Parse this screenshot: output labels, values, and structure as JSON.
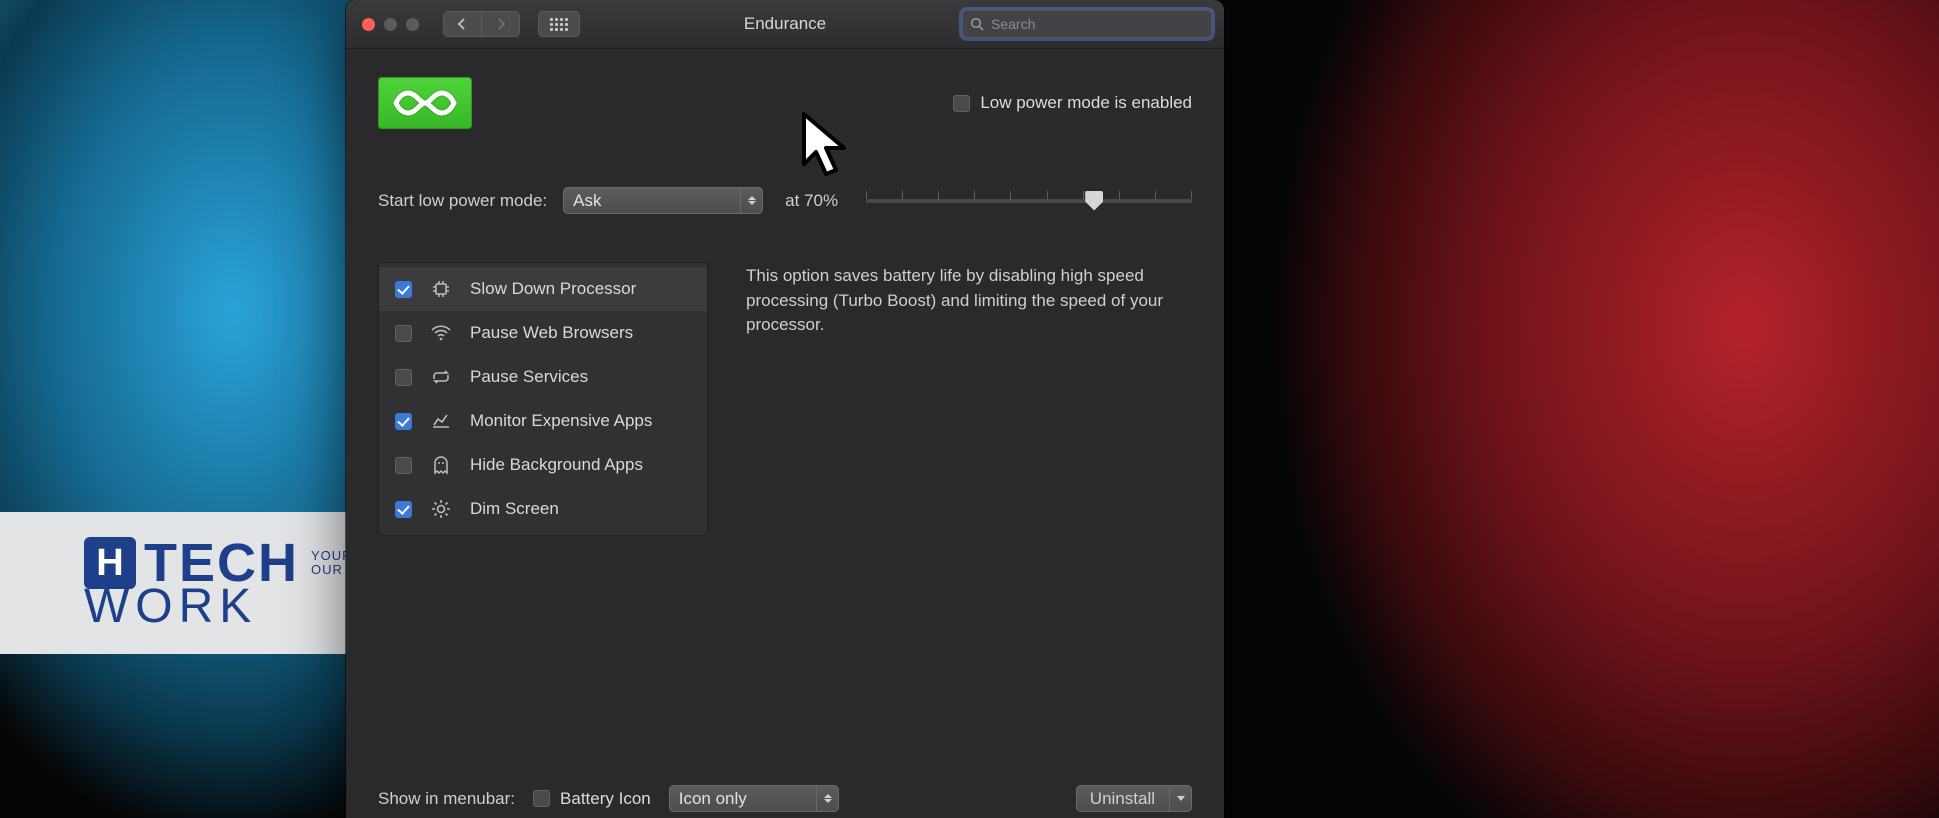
{
  "window": {
    "title": "Endurance"
  },
  "search": {
    "placeholder": "Search",
    "value": ""
  },
  "low_power_mode": {
    "checkbox_label": "Low power mode is enabled",
    "checked": false
  },
  "start_mode": {
    "label": "Start low power mode:",
    "select_value": "Ask",
    "at_label": "at 70%",
    "slider_percent": 70,
    "slider_tick_count": 10
  },
  "features": [
    {
      "id": "slow-cpu",
      "label": "Slow Down Processor",
      "checked": true,
      "icon": "cpu-icon",
      "selected": true
    },
    {
      "id": "pause-web",
      "label": "Pause Web Browsers",
      "checked": false,
      "icon": "wifi-icon",
      "selected": false
    },
    {
      "id": "pause-svc",
      "label": "Pause Services",
      "checked": false,
      "icon": "loop-icon",
      "selected": false
    },
    {
      "id": "mon-apps",
      "label": "Monitor Expensive Apps",
      "checked": true,
      "icon": "chart-icon",
      "selected": false
    },
    {
      "id": "hide-bg",
      "label": "Hide Background Apps",
      "checked": false,
      "icon": "ghost-icon",
      "selected": false
    },
    {
      "id": "dim",
      "label": "Dim Screen",
      "checked": true,
      "icon": "brightness-icon",
      "selected": false
    }
  ],
  "description": "This option saves battery life by disabling high speed processing (Turbo Boost) and limiting the speed of your processor.",
  "menubar": {
    "label": "Show in menubar:",
    "battery_icon_label": "Battery Icon",
    "battery_icon_checked": false,
    "select_value": "Icon only"
  },
  "uninstall": {
    "label": "Uninstall"
  },
  "watermark": {
    "line1": "TECH",
    "line2": "WORK",
    "tag1": "YOUR VISION",
    "tag2": "OUR FUTURE"
  }
}
